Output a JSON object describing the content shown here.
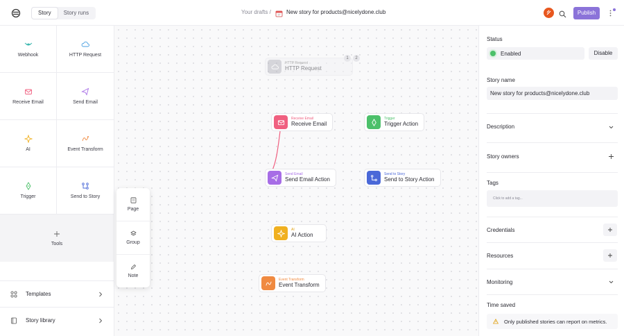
{
  "header": {
    "tabs": [
      {
        "label": "Story",
        "active": true
      },
      {
        "label": "Story runs",
        "active": false
      }
    ],
    "breadcrumb_root": "Your drafts",
    "breadcrumb_sep": "/",
    "story_title": "New story for products@nicelydone.club",
    "publish_label": "Publish",
    "accent_color": "#8b73d9"
  },
  "sidebar": {
    "actions": [
      {
        "label": "Webhook",
        "icon": "webhook-icon",
        "color": "#3fb8b0"
      },
      {
        "label": "HTTP Request",
        "icon": "cloud-icon",
        "color": "#4a9fe0"
      },
      {
        "label": "Receive Email",
        "icon": "mail-icon",
        "color": "#f06080"
      },
      {
        "label": "Send Email",
        "icon": "send-icon",
        "color": "#a76de6"
      },
      {
        "label": "AI",
        "icon": "sparkle-icon",
        "color": "#f0b020"
      },
      {
        "label": "Event Transform",
        "icon": "transform-icon",
        "color": "#f08a40"
      },
      {
        "label": "Trigger",
        "icon": "trigger-icon",
        "color": "#4cc06a"
      },
      {
        "label": "Send to Story",
        "icon": "story-icon",
        "color": "#4a68d8"
      }
    ],
    "tools_label": "Tools",
    "templates_label": "Templates",
    "library_label": "Story library"
  },
  "tools_menu": [
    {
      "label": "Page",
      "icon": "page-icon"
    },
    {
      "label": "Group",
      "icon": "layers-icon"
    },
    {
      "label": "Note",
      "icon": "pencil-icon"
    }
  ],
  "canvas": {
    "nodes": [
      {
        "id": "http",
        "sub": "HTTP Request",
        "main": "HTTP Request",
        "color": "#b8b8c0",
        "dim": true
      },
      {
        "id": "recv",
        "sub": "Receive Email",
        "main": "Receive Email",
        "color": "#f06080"
      },
      {
        "id": "trig",
        "sub": "Trigger",
        "main": "Trigger Action",
        "color": "#4cc06a"
      },
      {
        "id": "send",
        "sub": "Send Email",
        "main": "Send Email Action",
        "color": "#a76de6"
      },
      {
        "id": "sts",
        "sub": "Send to Story",
        "main": "Send to Story Action",
        "color": "#4a68d8"
      },
      {
        "id": "ai",
        "sub": "AI",
        "main": "AI Action",
        "color": "#f0b020"
      },
      {
        "id": "evt",
        "sub": "Event Transform",
        "main": "Event Transform",
        "color": "#f08a40"
      }
    ],
    "http_badges": [
      "1",
      "2"
    ]
  },
  "panel": {
    "status_title": "Status",
    "status_value": "Enabled",
    "disable_label": "Disable",
    "name_title": "Story name",
    "name_value": "New story for products@nicelydone.club",
    "description_title": "Description",
    "owners_title": "Story owners",
    "tags_title": "Tags",
    "tags_placeholder": "Click to add a tag...",
    "credentials_title": "Credentials",
    "resources_title": "Resources",
    "monitoring_title": "Monitoring",
    "time_saved_title": "Time saved",
    "metrics_warning": "Only published stories can report on metrics."
  }
}
